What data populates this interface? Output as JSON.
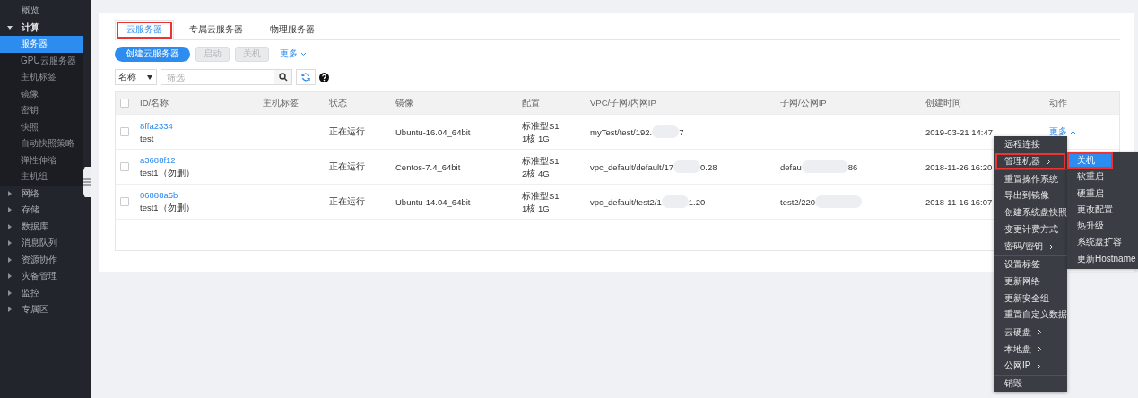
{
  "sidebar": {
    "items": [
      {
        "label": "概览",
        "kind": "link"
      },
      {
        "label": "计算",
        "kind": "group",
        "expanded": true,
        "children": [
          {
            "label": "服务器",
            "selected": true
          },
          {
            "label": "GPU云服务器",
            "selected": false
          },
          {
            "label": "主机标签",
            "selected": false
          },
          {
            "label": "镜像",
            "selected": false
          },
          {
            "label": "密钥",
            "selected": false
          },
          {
            "label": "快照",
            "selected": false
          },
          {
            "label": "自动快照策略",
            "selected": false
          },
          {
            "label": "弹性伸缩",
            "selected": false
          },
          {
            "label": "主机组",
            "selected": false
          }
        ]
      },
      {
        "label": "网络",
        "kind": "group",
        "expanded": false
      },
      {
        "label": "存储",
        "kind": "group",
        "expanded": false
      },
      {
        "label": "数据库",
        "kind": "group",
        "expanded": false
      },
      {
        "label": "消息队列",
        "kind": "group",
        "expanded": false
      },
      {
        "label": "资源协作",
        "kind": "group",
        "expanded": false
      },
      {
        "label": "灾备管理",
        "kind": "group",
        "expanded": false
      },
      {
        "label": "监控",
        "kind": "group",
        "expanded": false
      },
      {
        "label": "专属区",
        "kind": "group",
        "expanded": false
      }
    ]
  },
  "tabs": [
    {
      "label": "云服务器",
      "selected": true,
      "outlined": true
    },
    {
      "label": "专属云服务器",
      "selected": false,
      "outlined": false
    },
    {
      "label": "物理服务器",
      "selected": false,
      "outlined": false
    }
  ],
  "toolbar": {
    "buttons": [
      {
        "label": "创建云服务器",
        "disabled": false
      },
      {
        "label": "启动",
        "disabled": true
      },
      {
        "label": "关机",
        "disabled": true
      }
    ],
    "more": "更多"
  },
  "filter": {
    "field": "名称",
    "placeholder": "筛选"
  },
  "table": {
    "all_checked": false,
    "columns": [
      "ID/名称",
      "主机标签",
      "状态",
      "镜像",
      "配置",
      "VPC/子网/内网IP",
      "子网/公网IP",
      "创建时间",
      "动作"
    ],
    "rows": [
      {
        "id": "8ffa2334",
        "name": "test",
        "status": "正在运行",
        "image": "Ubuntu-16.04_64bit",
        "config": [
          "标准型S1",
          "1核 1G"
        ],
        "vpc_ip": [
          "myTest/test/192.",
          "7"
        ],
        "public_ip": [],
        "created": "2019-03-21 14:47",
        "action": "更多",
        "checked": false
      },
      {
        "id": "a3688f12",
        "name": "test1（勿删）",
        "status": "正在运行",
        "image": "Centos-7.4_64bit",
        "config": [
          "标准型S1",
          "2核 4G"
        ],
        "vpc_ip": [
          "vpc_default/default/17",
          "0.28"
        ],
        "public_ip": [
          "defau",
          "86"
        ],
        "created": "2018-11-26 16:20",
        "checked": false
      },
      {
        "id": "06888a5b",
        "name": "test1（勿删）",
        "status": "正在运行",
        "image": "Ubuntu-14.04_64bit",
        "config": [
          "标准型S1",
          "1核 1G"
        ],
        "vpc_ip": [
          "vpc_default/test2/1",
          "1.20"
        ],
        "public_ip": [
          "test2/220"
        ],
        "created": "2018-11-16 16:07",
        "checked": false
      }
    ]
  },
  "menu": {
    "groups": [
      [
        {
          "label": "远程连接",
          "has_submenu": false,
          "outlined": false
        },
        {
          "label": "管理机器",
          "has_submenu": true,
          "outlined": true
        }
      ],
      [
        {
          "label": "重置操作系统",
          "has_submenu": false,
          "outlined": false
        },
        {
          "label": "导出到镜像",
          "has_submenu": false,
          "outlined": false
        },
        {
          "label": "创建系统盘快照",
          "has_submenu": false,
          "outlined": false
        },
        {
          "label": "变更计费方式",
          "has_submenu": false,
          "outlined": false
        }
      ],
      [
        {
          "label": "密码/密钥",
          "has_submenu": true,
          "outlined": false
        }
      ],
      [
        {
          "label": "设置标签",
          "has_submenu": false,
          "outlined": false
        },
        {
          "label": "更新网络",
          "has_submenu": false,
          "outlined": false
        },
        {
          "label": "更新安全组",
          "has_submenu": false,
          "outlined": false
        },
        {
          "label": "重置自定义数据",
          "has_submenu": false,
          "outlined": false
        }
      ],
      [
        {
          "label": "云硬盘",
          "has_submenu": true,
          "outlined": false
        },
        {
          "label": "本地盘",
          "has_submenu": true,
          "outlined": false
        },
        {
          "label": "公网IP",
          "has_submenu": true,
          "outlined": false
        }
      ],
      [
        {
          "label": "销毁",
          "has_submenu": false,
          "outlined": false
        }
      ]
    ],
    "submenu": [
      {
        "label": "关机",
        "selected": true,
        "outlined": true
      },
      {
        "label": "软重启",
        "selected": false,
        "outlined": false
      },
      {
        "label": "硬重启",
        "selected": false,
        "outlined": false
      },
      {
        "label": "更改配置",
        "selected": false,
        "outlined": false
      },
      {
        "label": "热升级",
        "selected": false,
        "outlined": false
      },
      {
        "label": "系统盘扩容",
        "selected": false,
        "outlined": false
      },
      {
        "label": "更新Hostname",
        "selected": false,
        "outlined": false
      }
    ]
  }
}
